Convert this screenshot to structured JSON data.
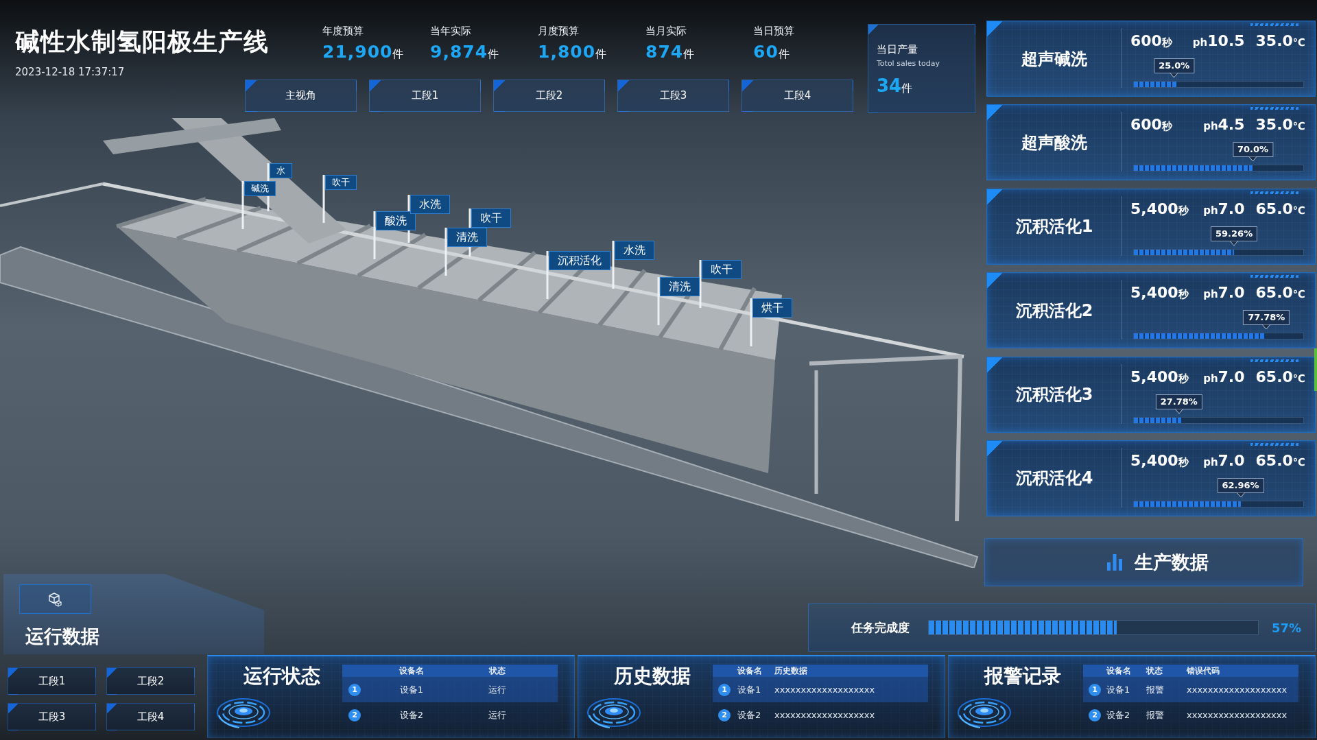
{
  "header": {
    "title": "碱性水制氢阳极生产线",
    "datetime": "2023-12-18 17:37:17"
  },
  "stats": [
    {
      "label": "年度预算",
      "value": "21,900",
      "unit": "件"
    },
    {
      "label": "当年实际",
      "value": "9,874",
      "unit": "件"
    },
    {
      "label": "月度预算",
      "value": "1,800",
      "unit": "件"
    },
    {
      "label": "当月实际",
      "value": "874",
      "unit": "件"
    },
    {
      "label": "当日预算",
      "value": "60",
      "unit": "件"
    }
  ],
  "view_tabs": [
    "主视角",
    "工段1",
    "工段2",
    "工段3",
    "工段4"
  ],
  "daily_output": {
    "label": "当日产量",
    "sublabel": "Totol sales today",
    "value": "34",
    "unit": "件"
  },
  "process_flags": [
    "碱洗",
    "水",
    "吹干",
    "酸洗",
    "水洗",
    "吹干",
    "清洗",
    "沉积活化",
    "水洗",
    "清洗",
    "吹干",
    "烘干"
  ],
  "stations": [
    {
      "name": "超声碱洗",
      "duration": "600",
      "duration_unit": "秒",
      "ph_label": "ph",
      "ph": "10.5",
      "temperature": "35.0",
      "temperature_unit": "℃",
      "level": 0.25,
      "percent": "25.0%"
    },
    {
      "name": "超声酸洗",
      "duration": "600",
      "duration_unit": "秒",
      "ph_label": "ph",
      "ph": "4.5",
      "temperature": "35.0",
      "temperature_unit": "℃",
      "level": 0.7,
      "percent": "70.0%"
    },
    {
      "name": "沉积活化1",
      "duration": "5,400",
      "duration_unit": "秒",
      "ph_label": "ph",
      "ph": "7.0",
      "temperature": "65.0",
      "temperature_unit": "℃",
      "level": 0.5926,
      "percent": "59.26%"
    },
    {
      "name": "沉积活化2",
      "duration": "5,400",
      "duration_unit": "秒",
      "ph_label": "ph",
      "ph": "7.0",
      "temperature": "65.0",
      "temperature_unit": "℃",
      "level": 0.7778,
      "percent": "77.78%"
    },
    {
      "name": "沉积活化3",
      "duration": "5,400",
      "duration_unit": "秒",
      "ph_label": "ph",
      "ph": "7.0",
      "temperature": "65.0",
      "temperature_unit": "℃",
      "level": 0.2778,
      "percent": "27.78%"
    },
    {
      "name": "沉积活化4",
      "duration": "5,400",
      "duration_unit": "秒",
      "ph_label": "ph",
      "ph": "7.0",
      "temperature": "65.0",
      "temperature_unit": "℃",
      "level": 0.6296,
      "percent": "62.96%"
    }
  ],
  "run_data": {
    "title": "运行数据",
    "section_buttons": [
      "工段1",
      "工段2",
      "工段3",
      "工段4"
    ]
  },
  "production_data": {
    "title": "生产数据",
    "task_label": "任务完成度",
    "level": 0.57,
    "percent": "57%"
  },
  "panels": [
    {
      "title": "运行状态",
      "columns": [
        "设备名",
        "状态"
      ],
      "rows": [
        {
          "index": "1",
          "cells": [
            "设备1",
            "运行"
          ]
        },
        {
          "index": "2",
          "cells": [
            "设备2",
            "运行"
          ]
        }
      ]
    },
    {
      "title": "历史数据",
      "columns": [
        "设备名",
        "历史数据"
      ],
      "rows": [
        {
          "index": "1",
          "cells": [
            "设备1",
            "xxxxxxxxxxxxxxxxxxx"
          ]
        },
        {
          "index": "2",
          "cells": [
            "设备2",
            "xxxxxxxxxxxxxxxxxxx"
          ]
        }
      ]
    },
    {
      "title": "报警记录",
      "columns": [
        "设备名",
        "状态",
        "错误代码"
      ],
      "rows": [
        {
          "index": "1",
          "cells": [
            "设备1",
            "报警",
            "xxxxxxxxxxxxxxxxxxx"
          ]
        },
        {
          "index": "2",
          "cells": [
            "设备2",
            "报警",
            "xxxxxxxxxxxxxxxxxxx"
          ]
        }
      ]
    }
  ]
}
